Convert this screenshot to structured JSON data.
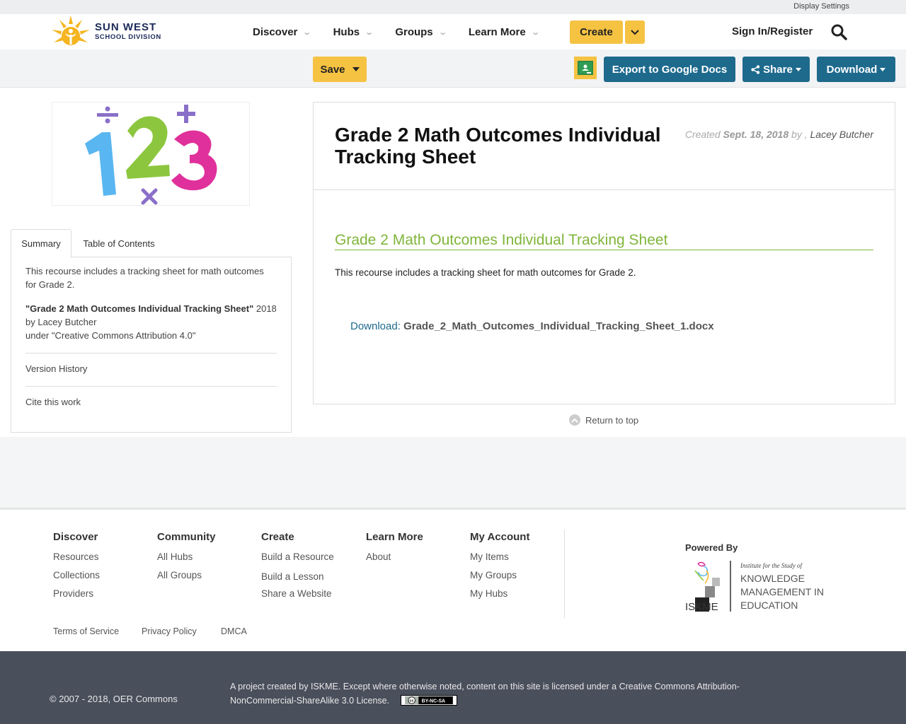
{
  "utility": {
    "display_settings": "Display Settings"
  },
  "header": {
    "logo_title": "SUN WEST",
    "logo_subtitle": "SCHOOL DIVISION",
    "nav": [
      "Discover",
      "Hubs",
      "Groups",
      "Learn More"
    ],
    "create_label": "Create",
    "signin_label": "Sign In/Register"
  },
  "toolbar": {
    "save_label": "Save",
    "export_label": "Export to Google Docs",
    "share_label": "Share",
    "download_label": "Download"
  },
  "tabs": {
    "summary": "Summary",
    "toc": "Table of Contents"
  },
  "summary": {
    "description": "This recourse includes a tracking sheet for math outcomes for Grade 2.",
    "cite_title": "\"Grade 2 Math Outcomes Individual Tracking Sheet\"",
    "cite_rest": " 2018 by Lacey Butcher",
    "cite_license": "under \"Creative Commons Attribution 4.0\"",
    "version_history": "Version History",
    "cite_work": "Cite this work"
  },
  "resource": {
    "title": "Grade 2 Math Outcomes Individual Tracking Sheet",
    "created_prefix": "Created",
    "created_date": "Sept. 18, 2018",
    "by": "by ,",
    "author": "Lacey Butcher",
    "section_title": "Grade 2 Math Outcomes Individual Tracking Sheet",
    "section_desc": "This recourse includes a tracking sheet for math outcomes for Grade 2.",
    "download_label": "Download:",
    "download_file": "Grade_2_Math_Outcomes_Individual_Tracking_Sheet_1.docx"
  },
  "return_top": "Return to top",
  "footer": {
    "columns": [
      {
        "heading": "Discover",
        "links": [
          "Resources",
          "Collections",
          "Providers"
        ]
      },
      {
        "heading": "Community",
        "links": [
          "All Hubs",
          "All Groups"
        ]
      },
      {
        "heading": "Create",
        "links": [
          "Build a Resource",
          "Build a Lesson",
          "Share a Website"
        ]
      },
      {
        "heading": "Learn More",
        "links": [
          "About"
        ]
      },
      {
        "heading": "My Account",
        "links": [
          "My Items",
          "My Groups",
          "My Hubs"
        ]
      }
    ],
    "powered_by": "Powered By",
    "iskme_small": "Institute for the Study of",
    "iskme_big1": "KNOWLEDGE",
    "iskme_big2": "MANAGEMENT IN",
    "iskme_big3": "EDUCATION",
    "iskme_mark": "ISKME",
    "legal": [
      "Terms of Service",
      "Privacy Policy",
      "DMCA"
    ],
    "copyright": "© 2007 - 2018, OER Commons",
    "license": "A project created by ISKME. Except where otherwise noted, content on this site is licensed under a Creative Commons Attribution-NonCommercial-ShareAlike 3.0 License.",
    "cc_badge": "BY-NC-SA"
  },
  "colors": {
    "accent_yellow": "#f5c242",
    "button_blue": "#1e6a8d",
    "link_green": "#7fb53a",
    "footer_dark": "#4a4f5c"
  }
}
